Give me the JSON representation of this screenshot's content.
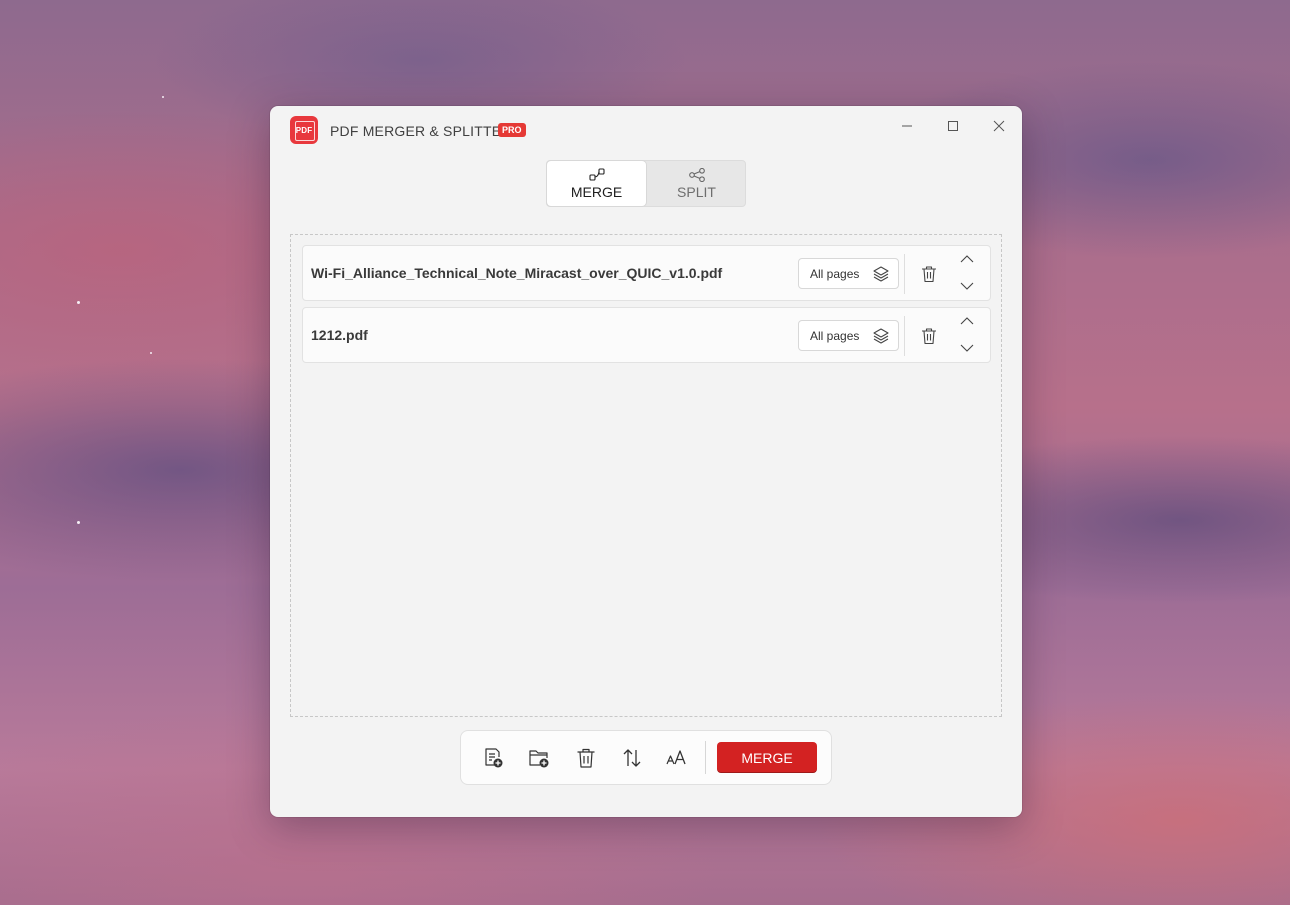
{
  "app": {
    "title": "PDF MERGER & SPLITTER",
    "badge": "PRO",
    "logo_text": "PDF",
    "accent_color": "#d32222"
  },
  "window_controls": [
    "minimize-icon",
    "maximize-icon",
    "close-icon"
  ],
  "tabs": [
    {
      "label": "MERGE",
      "icon": "merge-icon",
      "active": true
    },
    {
      "label": "SPLIT",
      "icon": "split-icon",
      "active": false
    }
  ],
  "files": [
    {
      "name": "Wi-Fi_Alliance_Technical_Note_Miracast_over_QUIC_v1.0.pdf",
      "pages_label": "All pages"
    },
    {
      "name": "1212.pdf",
      "pages_label": "All pages"
    }
  ],
  "toolbar": {
    "tools": [
      "add-file-icon",
      "add-folder-icon",
      "delete-all-icon",
      "sort-icon",
      "font-size-icon"
    ],
    "merge_label": "MERGE"
  }
}
